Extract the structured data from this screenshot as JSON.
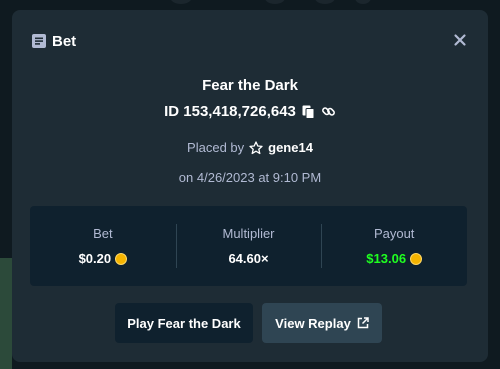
{
  "modal": {
    "header_title": "Bet",
    "game_title": "Fear the Dark",
    "bet_id": "ID 153,418,726,643",
    "placed_by_label": "Placed by",
    "username": "gene14",
    "date": "on 4/26/2023 at 9:10 PM"
  },
  "stats": {
    "bet": {
      "label": "Bet",
      "value": "$0.20"
    },
    "multiplier": {
      "label": "Multiplier",
      "value": "64.60×"
    },
    "payout": {
      "label": "Payout",
      "value": "$13.06",
      "color": "#1fff20"
    }
  },
  "buttons": {
    "play_label": "Play Fear the Dark",
    "replay_label": "View Replay"
  },
  "icons": [
    "bet-ticket-icon",
    "close-icon",
    "copy-icon",
    "link-icon",
    "star-icon",
    "coin-icon",
    "external-link-icon"
  ],
  "colors": {
    "modal_bg": "#1e2c35",
    "panel_bg": "#0f212e",
    "muted_text": "#b1bad3",
    "accent_green": "#1fff20",
    "coin": "#f5b400"
  }
}
